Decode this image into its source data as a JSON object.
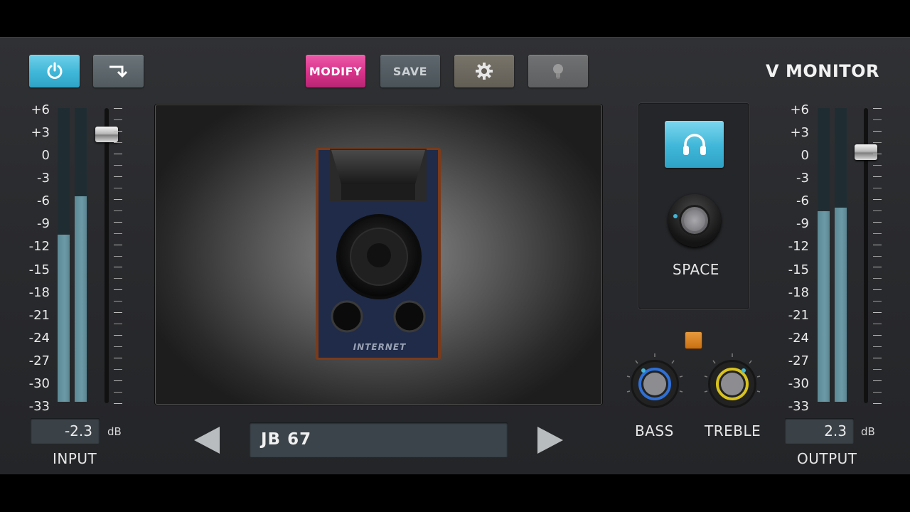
{
  "app": {
    "title": "V MONITOR"
  },
  "toolbar": {
    "power_icon": "power-icon",
    "bypass_icon": "bypass-arrow-icon",
    "modify_label": "MODIFY",
    "save_label": "SAVE",
    "settings_icon": "gear-icon",
    "lightbulb_icon": "lightbulb-icon"
  },
  "scale_labels": [
    "+6",
    "+3",
    "0",
    "-3",
    "-6",
    "-9",
    "-12",
    "-15",
    "-18",
    "-21",
    "-24",
    "-27",
    "-30",
    "-33"
  ],
  "input": {
    "label": "INPUT",
    "value": "-2.3",
    "unit": "dB",
    "meter_levels_fraction": [
      0.57,
      0.7
    ],
    "fader_level_fraction": 0.91
  },
  "output": {
    "label": "OUTPUT",
    "value": "2.3",
    "unit": "dB",
    "meter_levels_fraction": [
      0.65,
      0.66
    ],
    "fader_level_fraction": 0.85
  },
  "speaker": {
    "brand": "INTERNET"
  },
  "preset": {
    "name": "JB 67",
    "prev_icon": "triangle-left-icon",
    "next_icon": "triangle-right-icon"
  },
  "space": {
    "label": "SPACE",
    "headphone_icon": "headphones-icon"
  },
  "bass": {
    "label": "BASS",
    "ring_color": "#2f6fd6"
  },
  "treble": {
    "label": "TREBLE",
    "ring_color": "#d8c21d"
  },
  "colors": {
    "accent_blue": "#3fb6d8",
    "modify_pink": "#d8328a",
    "indicator_orange": "#d8811e"
  }
}
